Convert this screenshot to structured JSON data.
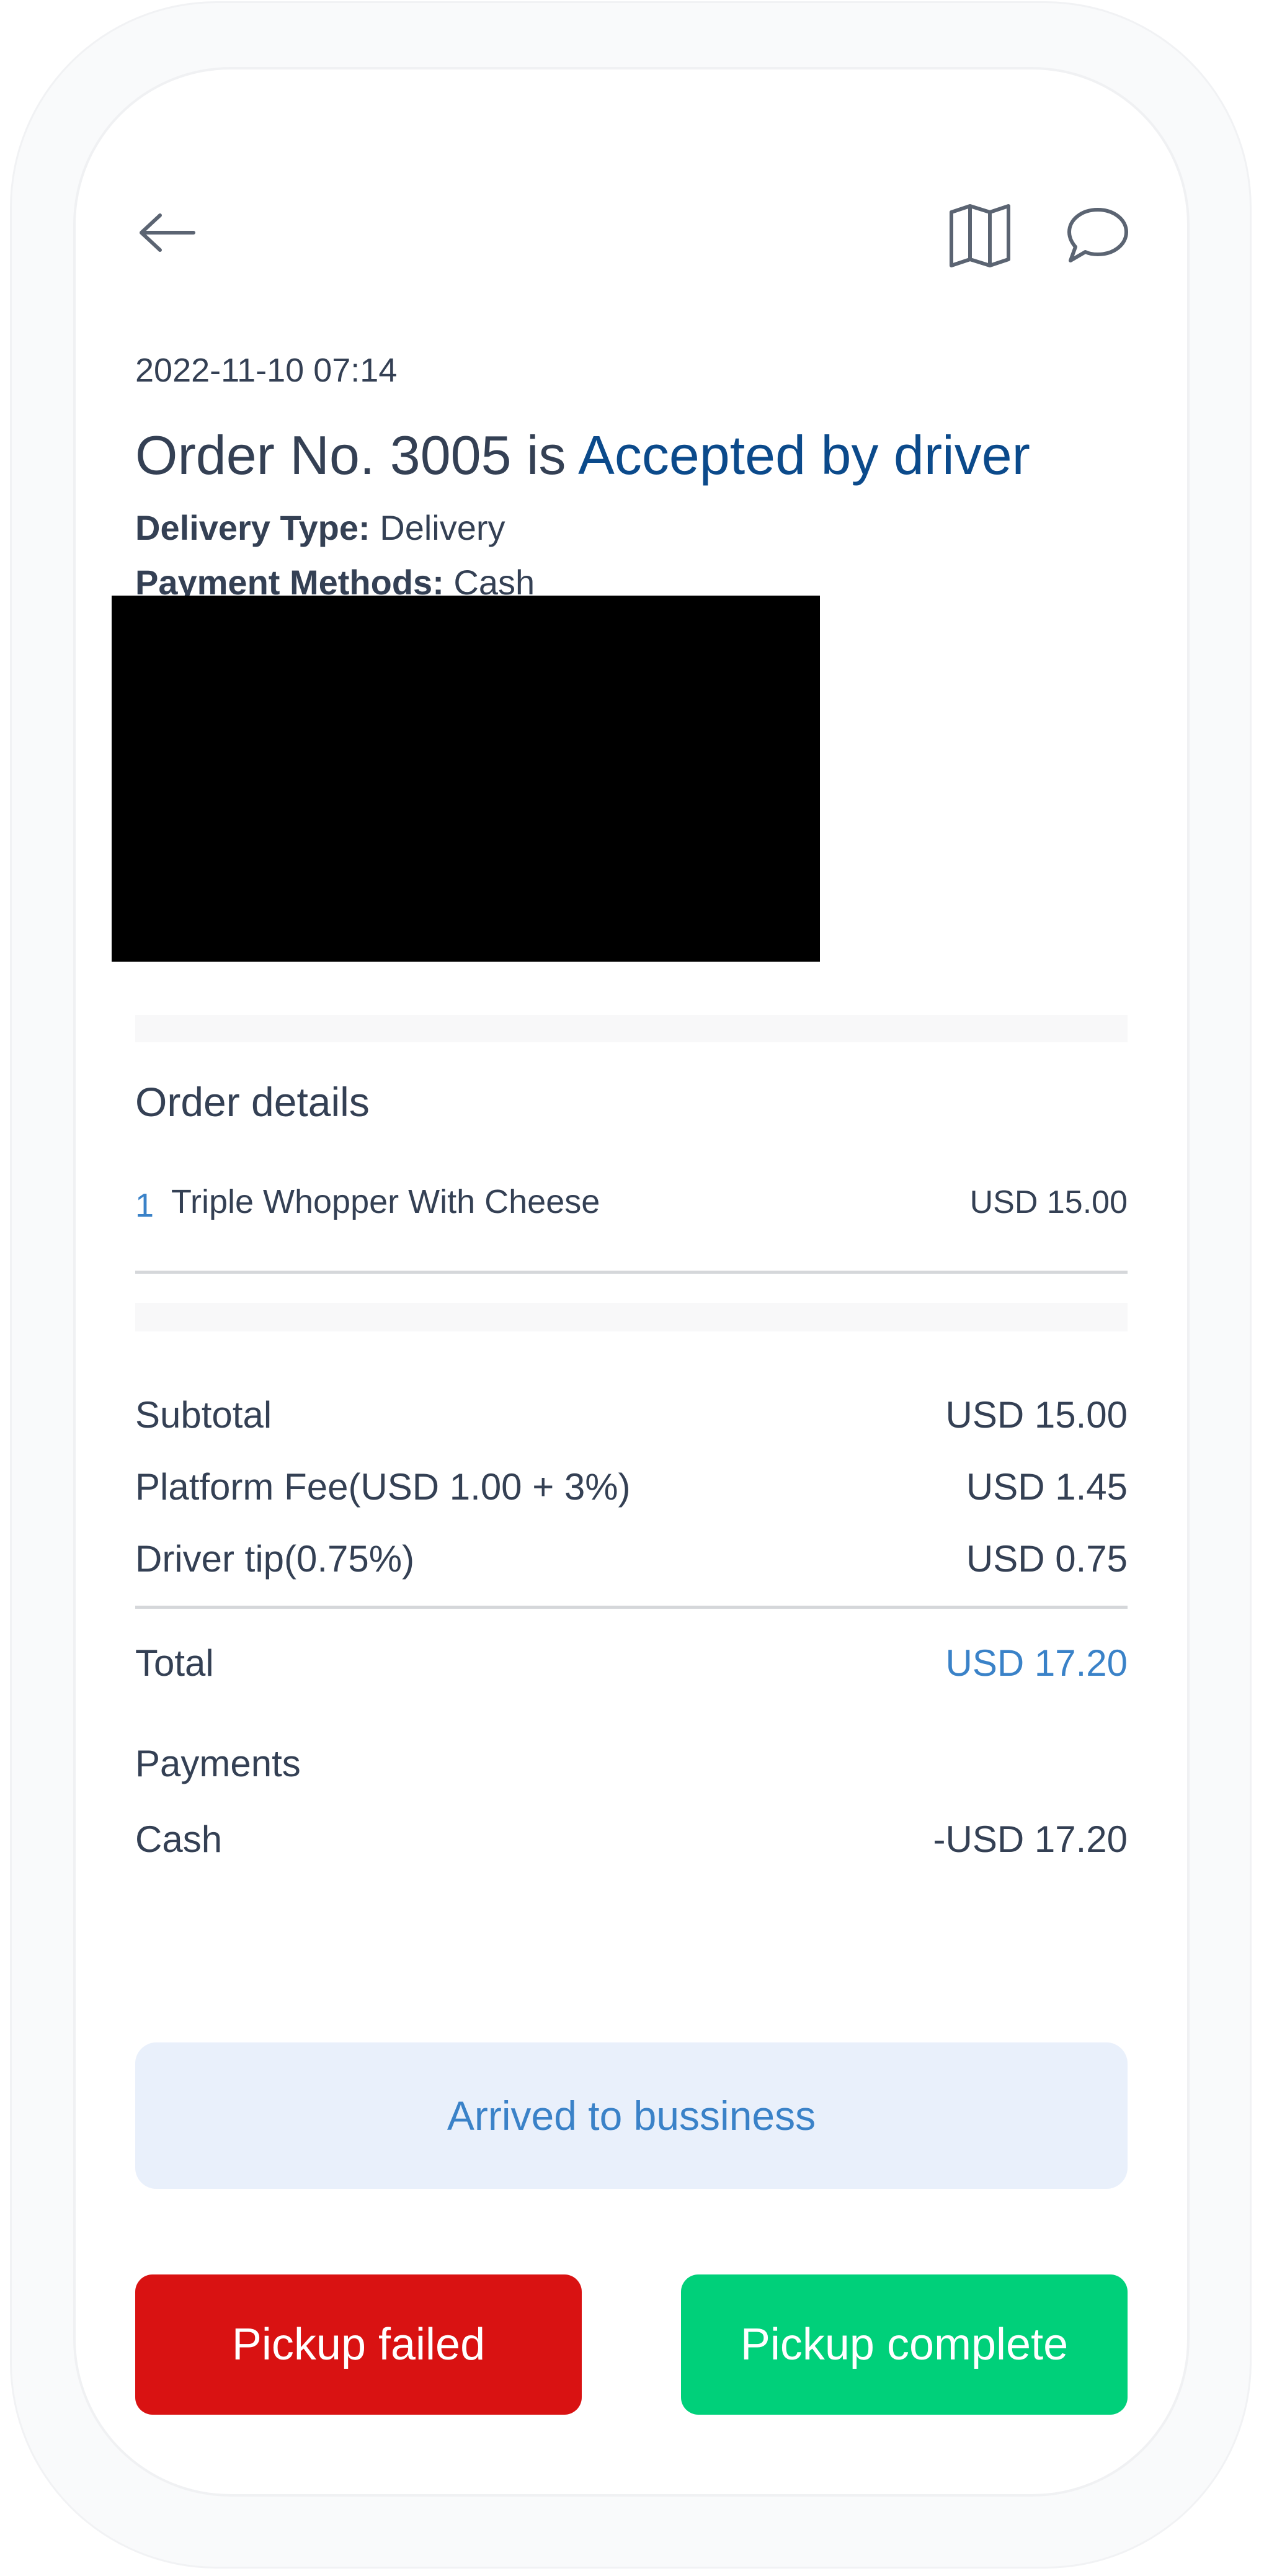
{
  "header": {
    "back_icon": "arrow-left-icon",
    "map_icon": "map-icon",
    "chat_icon": "chat-bubble-icon"
  },
  "order": {
    "timestamp": "2022-11-10 07:14",
    "title_prefix": "Order No. 3005 is ",
    "status": "Accepted by driver",
    "delivery_type_label": "Delivery Type:",
    "delivery_type_value": "Delivery",
    "payment_methods_label": "Payment Methods:",
    "payment_methods_value": "Cash"
  },
  "details": {
    "heading": "Order details",
    "items": [
      {
        "qty": "1",
        "name": "Triple Whopper With Cheese",
        "price": "USD 15.00"
      }
    ]
  },
  "summary": {
    "subtotal_label": "Subtotal",
    "subtotal_value": "USD 15.00",
    "platform_fee_label": "Platform Fee(USD 1.00 + 3%)",
    "platform_fee_value": "USD 1.45",
    "driver_tip_label": "Driver tip(0.75%)",
    "driver_tip_value": "USD 0.75",
    "total_label": "Total",
    "total_value": "USD 17.20",
    "payments_heading": "Payments",
    "payment_method_label": "Cash",
    "payment_method_value": "-USD 17.20"
  },
  "actions": {
    "arrived_label": "Arrived to bussiness",
    "pickup_failed_label": "Pickup failed",
    "pickup_complete_label": "Pickup complete"
  },
  "colors": {
    "accent_blue": "#0b4a8b",
    "link_blue": "#3a82c8",
    "arrived_bg": "#e9f0fb",
    "danger": "#d91212",
    "success": "#00d07a"
  }
}
